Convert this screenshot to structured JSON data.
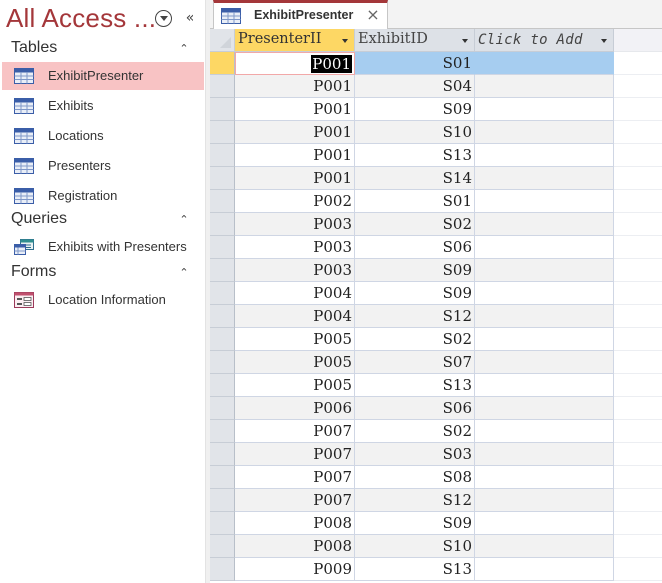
{
  "nav": {
    "title": "All Access ...",
    "groups": [
      {
        "label": "Tables",
        "items": [
          {
            "label": "ExhibitPresenter",
            "icon": "table-icon",
            "selected": true
          },
          {
            "label": "Exhibits",
            "icon": "table-icon"
          },
          {
            "label": "Locations",
            "icon": "table-icon"
          },
          {
            "label": "Presenters",
            "icon": "table-icon"
          },
          {
            "label": "Registration",
            "icon": "table-icon"
          }
        ]
      },
      {
        "label": "Queries",
        "items": [
          {
            "label": "Exhibits with Presenters",
            "icon": "query-icon"
          }
        ]
      },
      {
        "label": "Forms",
        "items": [
          {
            "label": "Location Information",
            "icon": "form-icon"
          }
        ]
      }
    ],
    "collapse_glyph": "«",
    "group_chevron_glyph": "⌃"
  },
  "tab": {
    "label": "ExhibitPresenter",
    "close_glyph": "×"
  },
  "datasheet": {
    "columns": [
      "PresenterII",
      "ExhibitID",
      "Click to Add"
    ],
    "rows": [
      [
        "P001",
        "S01"
      ],
      [
        "P001",
        "S04"
      ],
      [
        "P001",
        "S09"
      ],
      [
        "P001",
        "S10"
      ],
      [
        "P001",
        "S13"
      ],
      [
        "P001",
        "S14"
      ],
      [
        "P002",
        "S01"
      ],
      [
        "P003",
        "S02"
      ],
      [
        "P003",
        "S06"
      ],
      [
        "P003",
        "S09"
      ],
      [
        "P004",
        "S09"
      ],
      [
        "P004",
        "S12"
      ],
      [
        "P005",
        "S02"
      ],
      [
        "P005",
        "S07"
      ],
      [
        "P005",
        "S13"
      ],
      [
        "P006",
        "S06"
      ],
      [
        "P007",
        "S02"
      ],
      [
        "P007",
        "S03"
      ],
      [
        "P007",
        "S08"
      ],
      [
        "P007",
        "S12"
      ],
      [
        "P008",
        "S09"
      ],
      [
        "P008",
        "S10"
      ],
      [
        "P009",
        "S13"
      ]
    ]
  },
  "colors": {
    "accent": "#a4373a",
    "selected_nav": "#f8c3c4",
    "active_header": "#fdd764",
    "selected_row": "#a6cdf0"
  }
}
